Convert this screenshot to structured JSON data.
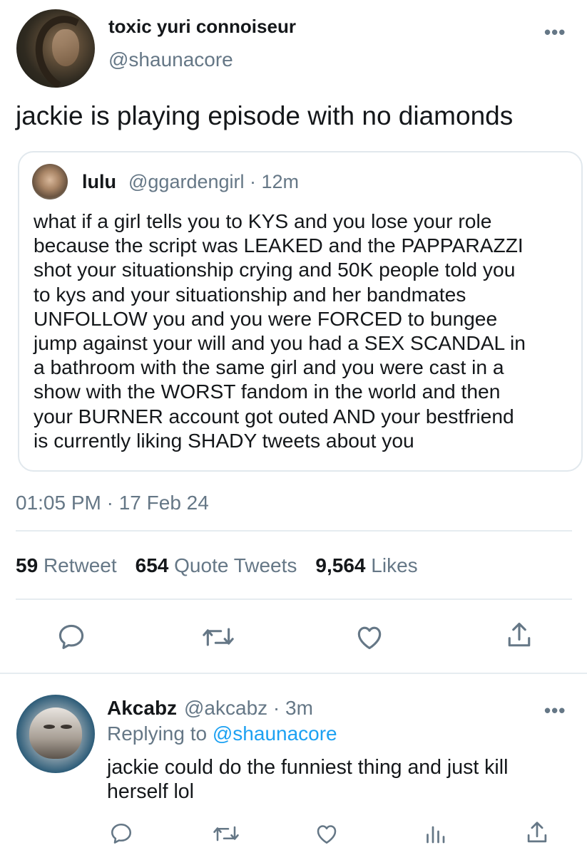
{
  "tweet": {
    "display_name": "toxic yuri connoiseur",
    "handle": "@shaunacore",
    "more_label": "•••",
    "text": "jackie is playing episode with no diamonds",
    "quoted": {
      "display_name": "lulu",
      "handle_time": "@ggardengirl · 12m",
      "text_lines": [
        "what if a girl tells you to KYS and you lose your role",
        "because the script was LEAKED and the PAPPARAZZI",
        "shot your situationship crying and 50K people told you",
        "to kys and your situationship and her bandmates",
        "UNFOLLOW you and you were FORCED to bungee",
        "jump against your will and you had a SEX SCANDAL in",
        "a bathroom with the same girl and you were cast in a",
        "show with the WORST fandom in the world and then",
        "your BURNER account got outed AND your bestfriend",
        "is currently liking SHADY tweets about you"
      ]
    },
    "timestamp": "01:05 PM · 17 Feb 24",
    "stats": {
      "retweets_count": "59",
      "retweets_label": "Retweet",
      "quotes_count": "654",
      "quotes_label": "Quote Tweets",
      "likes_count": "9,564",
      "likes_label": "Likes"
    },
    "actions": [
      "reply-icon",
      "retweet-icon",
      "like-icon",
      "share-icon"
    ]
  },
  "reply": {
    "display_name": "Akcabz",
    "handle_time": "@akcabz · 3m",
    "more_label": "•••",
    "replying_prefix": "Replying to",
    "replying_mention": "@shaunacore",
    "text_lines": [
      "jackie could do the funniest thing and just kill",
      "herself lol"
    ],
    "actions": [
      "reply-icon",
      "retweet-icon",
      "like-icon",
      "analytics-icon",
      "share-icon"
    ]
  },
  "colors": {
    "text": "#14171a",
    "secondary": "#657786",
    "link": "#1da1f2",
    "divider": "#e6ecf0"
  }
}
